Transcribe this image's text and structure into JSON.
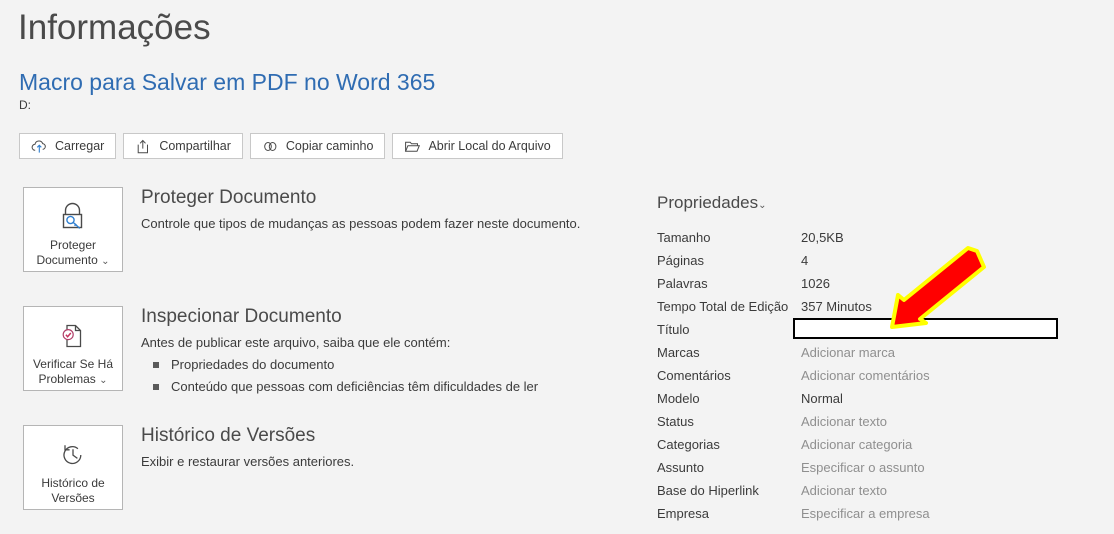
{
  "header": {
    "page_title": "Informações",
    "document_name": "Macro para Salvar em PDF no Word 365",
    "document_path": "D:"
  },
  "toolbar": {
    "buttons": [
      {
        "label": "Carregar",
        "icon": "cloud-upload-icon"
      },
      {
        "label": "Compartilhar",
        "icon": "share-icon"
      },
      {
        "label": "Copiar caminho",
        "icon": "link-icon"
      },
      {
        "label": "Abrir Local do Arquivo",
        "icon": "folder-open-icon"
      }
    ]
  },
  "sections": [
    {
      "card_label_line1": "Proteger",
      "card_label_line2": "Documento",
      "card_chevron": "⌄",
      "card_icon": "lock-key-icon",
      "heading": "Proteger Documento",
      "description": "Controle que tipos de mudanças as pessoas podem fazer neste documento.",
      "bullets": []
    },
    {
      "card_label_line1": "Verificar Se Há",
      "card_label_line2": "Problemas",
      "card_chevron": "⌄",
      "card_icon": "document-check-icon",
      "heading": "Inspecionar Documento",
      "description": "Antes de publicar este arquivo, saiba que ele contém:",
      "bullets": [
        "Propriedades do documento",
        "Conteúdo que pessoas com deficiências têm dificuldades de ler"
      ]
    },
    {
      "card_label_line1": "Histórico de",
      "card_label_line2": "Versões",
      "card_chevron": "",
      "card_icon": "clock-history-icon",
      "heading": "Histórico de Versões",
      "description": "Exibir e restaurar versões anteriores.",
      "bullets": []
    }
  ],
  "properties": {
    "title": "Propriedades",
    "chevron": "⌄",
    "rows": [
      {
        "label": "Tamanho",
        "value": "20,5KB",
        "placeholder": false
      },
      {
        "label": "Páginas",
        "value": "4",
        "placeholder": false
      },
      {
        "label": "Palavras",
        "value": "1026",
        "placeholder": false
      },
      {
        "label": "Tempo Total de Edição",
        "value": "357 Minutos",
        "placeholder": false
      },
      {
        "label": "Título",
        "value": "",
        "placeholder": false,
        "input": true
      },
      {
        "label": "Marcas",
        "value": "Adicionar marca",
        "placeholder": true
      },
      {
        "label": "Comentários",
        "value": "Adicionar comentários",
        "placeholder": true
      },
      {
        "label": "Modelo",
        "value": "Normal",
        "placeholder": false
      },
      {
        "label": "Status",
        "value": "Adicionar texto",
        "placeholder": true
      },
      {
        "label": "Categorias",
        "value": "Adicionar categoria",
        "placeholder": true
      },
      {
        "label": "Assunto",
        "value": "Especificar o assunto",
        "placeholder": true
      },
      {
        "label": "Base do Hiperlink",
        "value": "Adicionar texto",
        "placeholder": true
      },
      {
        "label": "Empresa",
        "value": "Especificar a empresa",
        "placeholder": true
      }
    ]
  },
  "annotation": {
    "name": "red-arrow-annotation",
    "fill_color": "#FF0000",
    "outline_color": "#FFFF00",
    "points_to": "Título"
  },
  "colors": {
    "background": "#F3F3F3",
    "accent_link": "#2F6CB2",
    "heading": "#4A4A4A",
    "body_text": "#3B3B3B",
    "placeholder_text": "#8F8F8F",
    "card_border": "#B5B5B5",
    "button_border": "#C8C8C8"
  }
}
